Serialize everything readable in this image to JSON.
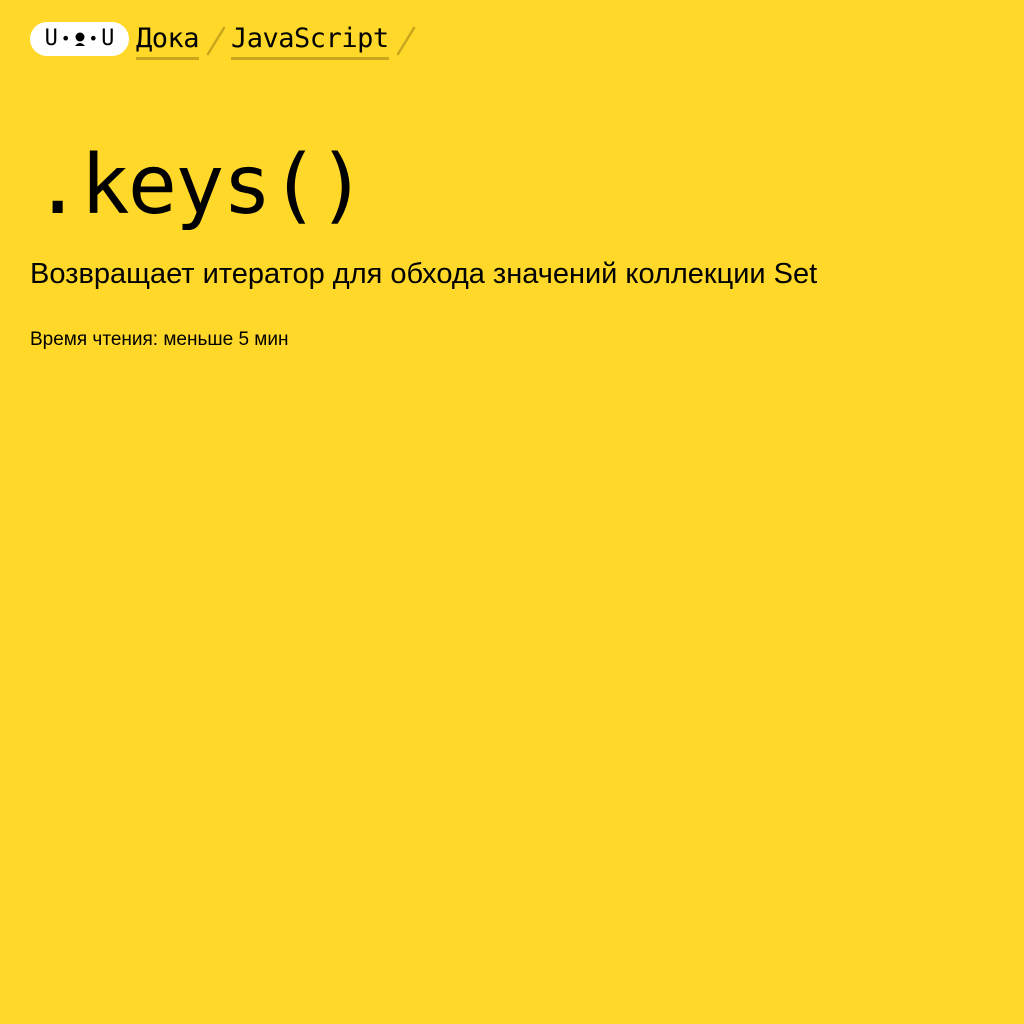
{
  "header": {
    "logo": {
      "left": "U",
      "right": "U",
      "dot": "•",
      "icon": "doka-face-logo-icon"
    },
    "breadcrumbs": [
      {
        "label": "Дока"
      },
      {
        "label": "JavaScript"
      }
    ],
    "separator_icon": "slash-separator-icon"
  },
  "article": {
    "title": ".keys()",
    "description": "Возвращает итератор для обхода значений коллекции Set",
    "reading_time": "Время чтения: меньше 5 мин"
  },
  "colors": {
    "background": "#FFD829",
    "underline": "#C9A61C",
    "logo_background": "#FFFFFF",
    "text": "#000000"
  }
}
